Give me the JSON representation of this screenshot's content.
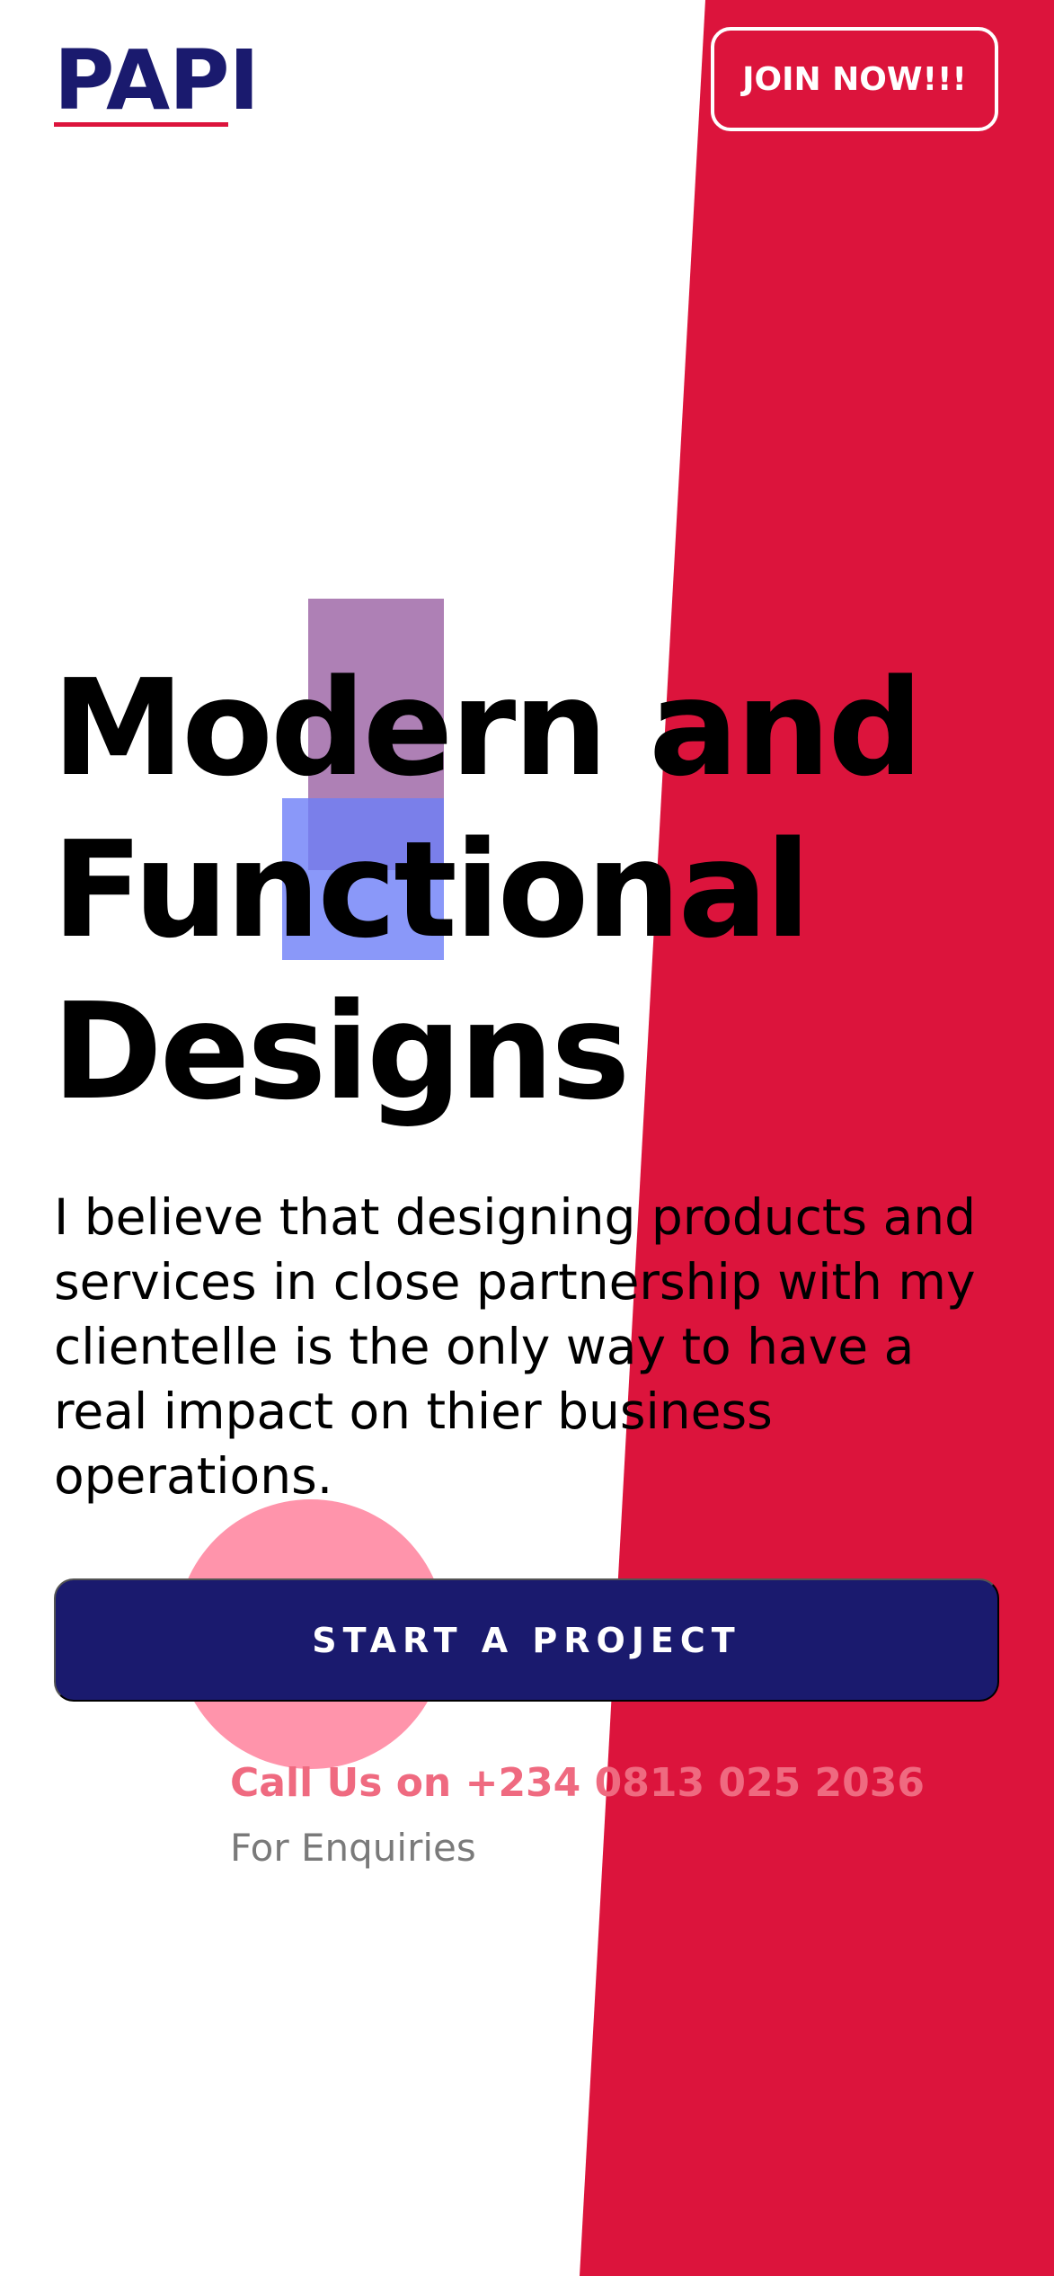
{
  "header": {
    "logo_text": "PAPI",
    "join_label": "JOIN NOW!!!"
  },
  "hero": {
    "headline_lines": [
      "Modern and",
      "Functional",
      "Designs"
    ],
    "description": "I believe that designing products and services in close partnership with my clientelle is the only way to have a real impact on thier business operations.",
    "cta_label": "START A PROJECT",
    "call_text": "Call Us on +234 0813 025 2036",
    "enquiries_text": "For Enquiries"
  },
  "colors": {
    "brand_navy": "#1a1a6e",
    "accent_red": "#dc143c",
    "pink_circle": "#ff94ab",
    "call_text": "#ef6a80",
    "deco_purple": "#a06aa8",
    "deco_blue": "#6d7ef8",
    "muted_text": "#7a7a7a"
  }
}
